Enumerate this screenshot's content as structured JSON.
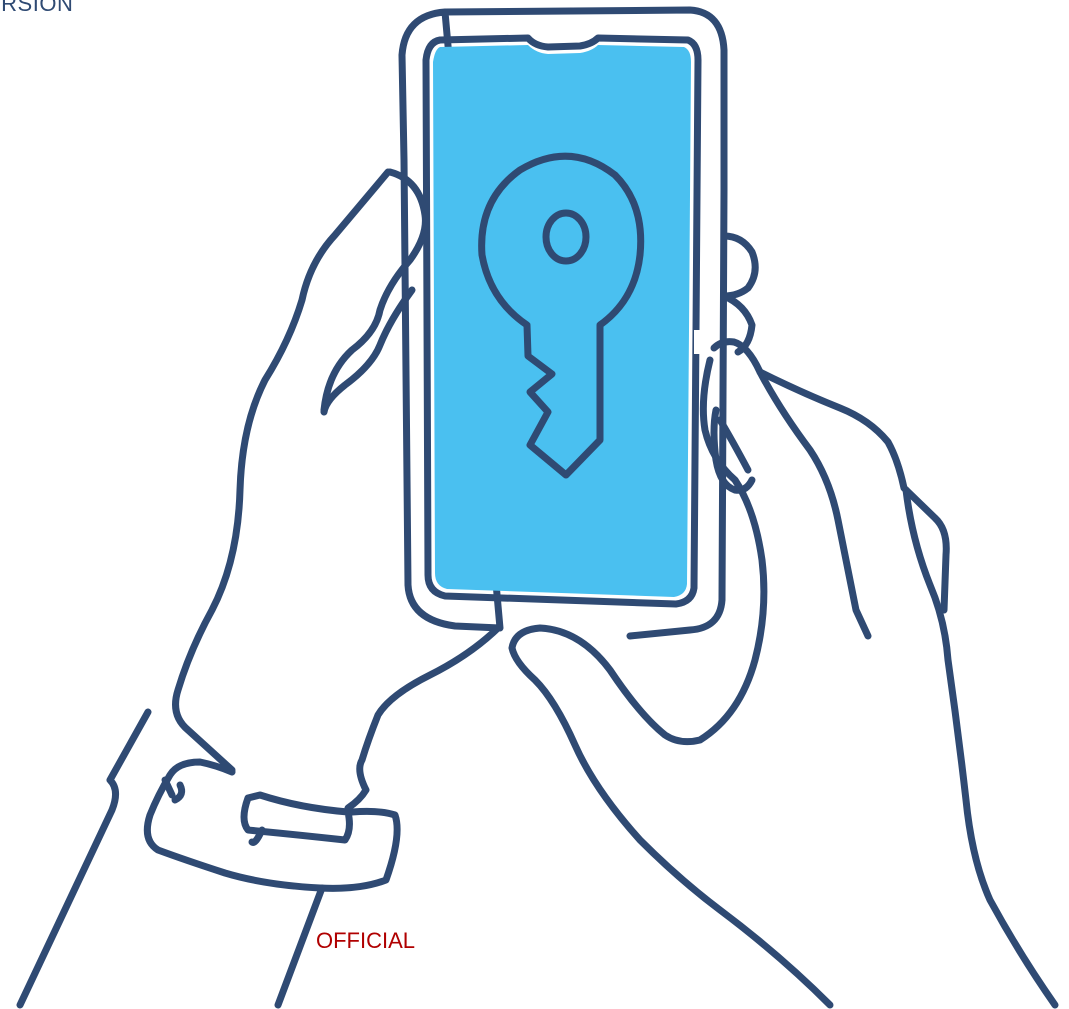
{
  "header": {
    "partial_text": "ERSION"
  },
  "labels": {
    "classification": "OFFICIAL"
  },
  "colors": {
    "outline": "#2f4a73",
    "screen": "#4ac0f0",
    "classification_text": "#b00000",
    "background": "#ffffff"
  },
  "illustration": {
    "subject": "hands-holding-phone",
    "screen_icon": "key-icon"
  }
}
